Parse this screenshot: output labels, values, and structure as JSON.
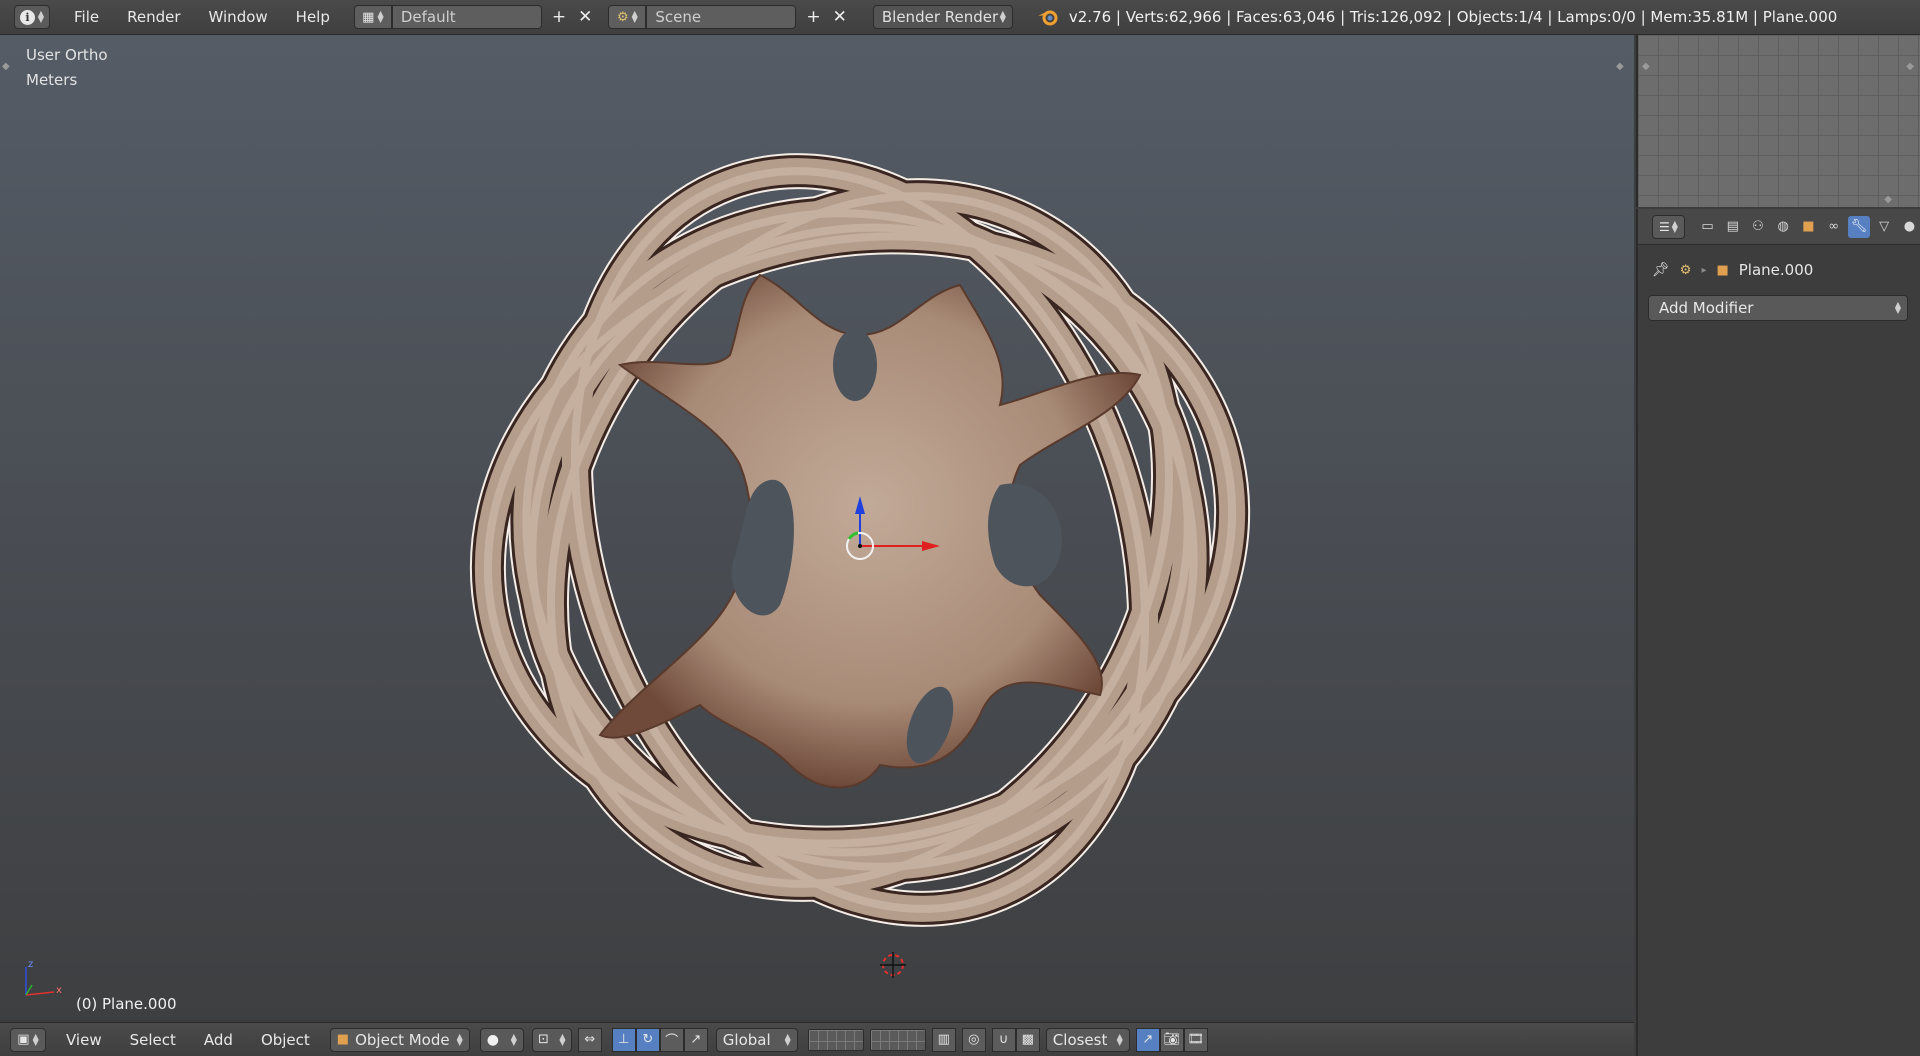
{
  "top_header": {
    "editor_type_icon": "info-icon",
    "menus": [
      "File",
      "Render",
      "Window",
      "Help"
    ],
    "screen_layout": "Default",
    "scene": "Scene",
    "render_engine": "Blender Render",
    "stats": "v2.76 | Verts:62,966 | Faces:63,046 | Tris:126,092 | Objects:1/4 | Lamps:0/0 | Mem:35.81M | Plane.000"
  },
  "viewport": {
    "view_name": "User Ortho",
    "units": "Meters",
    "object_label": "(0) Plane.000",
    "axis_z_label": "z",
    "axis_x_label": "x",
    "colors": {
      "mesh": "#b59d8c",
      "manipulator_x": "#e02020",
      "manipulator_y": "#30c030",
      "manipulator_z": "#2040e0"
    }
  },
  "properties": {
    "tabs": [
      "render-icon",
      "render-layers-icon",
      "scene-icon",
      "world-icon",
      "object-icon",
      "constraints-icon",
      "modifiers-icon",
      "data-icon",
      "material-icon"
    ],
    "active_tab": "modifiers-icon",
    "breadcrumb_object": "Plane.000",
    "add_modifier_label": "Add Modifier"
  },
  "bottom_header": {
    "menus": [
      "View",
      "Select",
      "Add",
      "Object"
    ],
    "mode": "Object Mode",
    "orientation": "Global",
    "snap_target": "Closest"
  }
}
